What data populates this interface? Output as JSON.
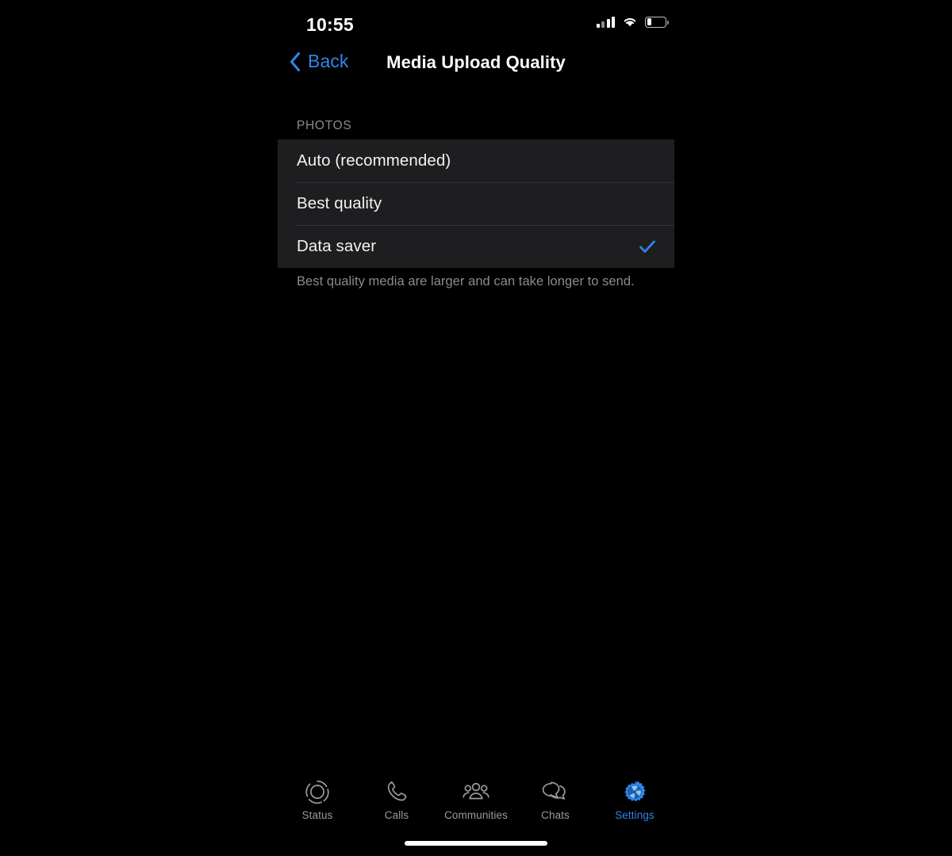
{
  "status_bar": {
    "time": "10:55",
    "cellular_icon": "cellular-signal-icon",
    "wifi_icon": "wifi-icon",
    "battery_icon": "battery-low-icon",
    "battery_level_percent": 25
  },
  "nav": {
    "back_label": "Back",
    "back_icon": "chevron-left-icon",
    "title": "Media Upload Quality"
  },
  "content": {
    "section_header": "PHOTOS",
    "options": [
      {
        "label": "Auto (recommended)",
        "selected": false
      },
      {
        "label": "Best quality",
        "selected": false
      },
      {
        "label": "Data saver",
        "selected": true
      }
    ],
    "checkmark_icon": "checkmark-icon",
    "footer_note": "Best quality media are larger and can take longer to send."
  },
  "tab_bar": {
    "items": [
      {
        "label": "Status",
        "icon": "status-ring-icon",
        "active": false
      },
      {
        "label": "Calls",
        "icon": "phone-icon",
        "active": false
      },
      {
        "label": "Communities",
        "icon": "communities-people-icon",
        "active": false
      },
      {
        "label": "Chats",
        "icon": "chat-bubbles-icon",
        "active": false
      },
      {
        "label": "Settings",
        "icon": "gear-icon",
        "active": true
      }
    ]
  },
  "colors": {
    "background": "#000000",
    "cell_background": "#1e1e20",
    "separator": "#343436",
    "accent_blue": "#2f86e8",
    "primary_text": "#f2f2f2",
    "secondary_text": "#8b8b8f"
  }
}
